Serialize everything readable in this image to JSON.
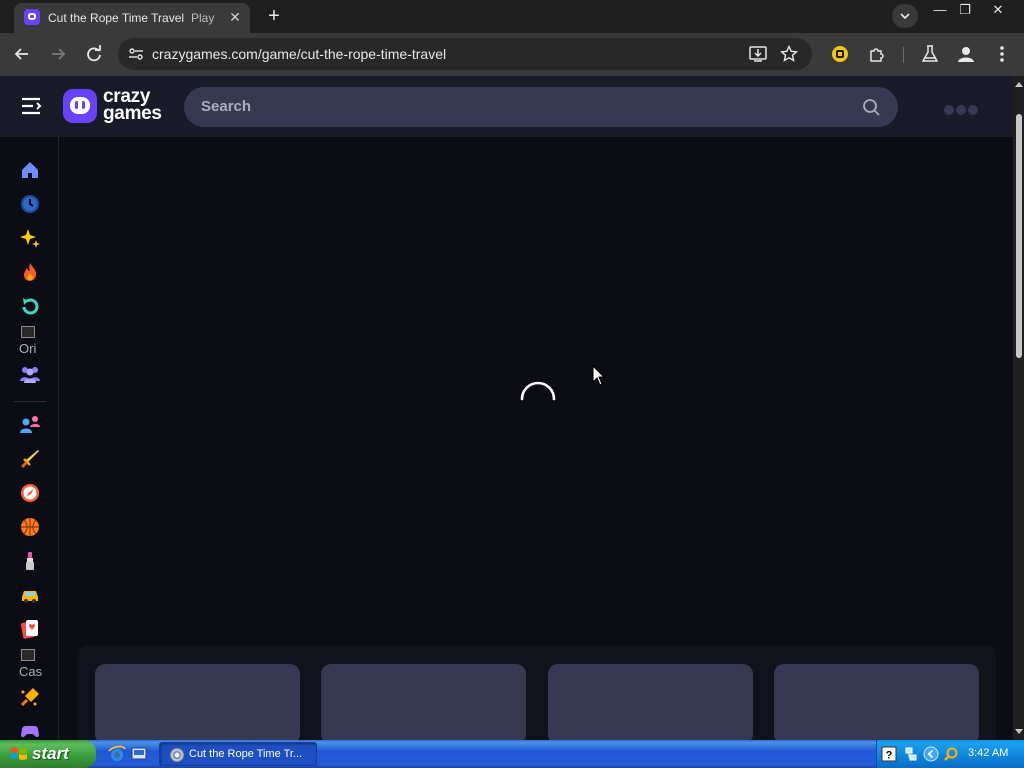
{
  "browser": {
    "tab": {
      "title": "Cut the Rope Time Travel",
      "title2": "Play",
      "close": "✕"
    },
    "newtab": "+",
    "window": {
      "minimize": "—",
      "restore": "❐",
      "close": "✕"
    },
    "omnibox": {
      "url_host": "crazygames.com",
      "url_path": "/game/cut-the-rope-time-travel"
    }
  },
  "site": {
    "logo_line1": "crazy",
    "logo_line2": "games",
    "search_placeholder": "Search"
  },
  "sidebar": {
    "items": [
      {
        "name": "home",
        "icon": "home-icon",
        "color": "#6f8cff"
      },
      {
        "name": "recent",
        "icon": "clock-icon",
        "color": "#2c6ac9"
      },
      {
        "name": "new",
        "icon": "sparkles-icon",
        "color": "#ffcd00"
      },
      {
        "name": "trending",
        "icon": "fire-icon",
        "color": "#ff5a1f"
      },
      {
        "name": "updated",
        "icon": "refresh-icon",
        "color": "#3ed8c0"
      },
      {
        "name": "originals",
        "label": "Ori"
      },
      {
        "name": "multiplayer",
        "icon": "group-icon",
        "color": "#8e7cff"
      },
      {
        "name": "2-player",
        "icon": "two-players-icon",
        "color": "#4aa8ff"
      },
      {
        "name": "action",
        "icon": "sword-icon",
        "color": "#ffd34d"
      },
      {
        "name": "adventure",
        "icon": "compass-icon",
        "color": "#ff5a3c"
      },
      {
        "name": "basketball",
        "icon": "basketball-icon",
        "color": "#ff7a1a"
      },
      {
        "name": "beauty",
        "icon": "beauty-icon",
        "color": "#ff4fa3"
      },
      {
        "name": "car",
        "icon": "car-icon",
        "color": "#ffb400"
      },
      {
        "name": "card",
        "icon": "card-icon",
        "color": "#ff4a4a"
      },
      {
        "name": "casual",
        "label": "Cas"
      },
      {
        "name": "clicker",
        "icon": "clicker-icon",
        "color": "#ffb100"
      },
      {
        "name": "controller",
        "icon": "gamepad-icon",
        "color": "#a374ff"
      }
    ]
  },
  "taskbar": {
    "start_label": "start",
    "task_label": "Cut the Rope Time Tr...",
    "clock": "3:42 AM"
  }
}
